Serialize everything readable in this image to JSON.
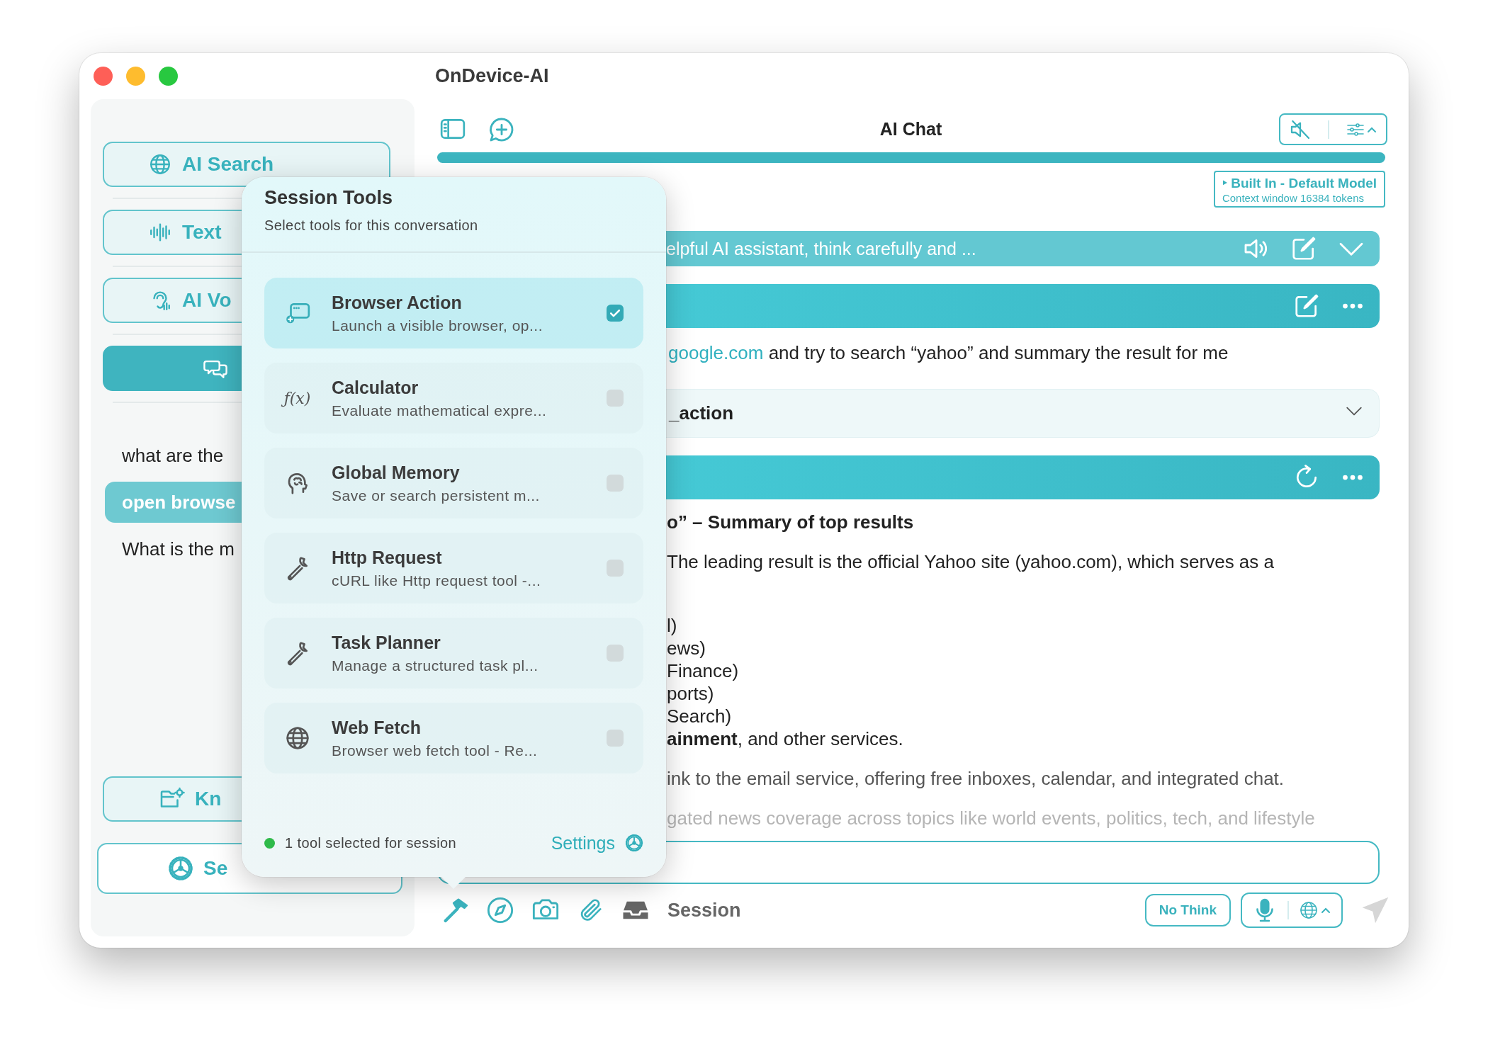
{
  "window": {
    "title": "OnDevice-AI"
  },
  "sidebar": {
    "nav": [
      {
        "label": "AI Search",
        "selected": false
      },
      {
        "label": "Text",
        "selected": false
      },
      {
        "label": "AI Vo",
        "selected": false
      },
      {
        "selected": true
      }
    ],
    "history": [
      {
        "text": "what are the",
        "selected": false
      },
      {
        "text": "open browse",
        "selected": true
      },
      {
        "text": "What is the m",
        "selected": false
      }
    ],
    "footer_buttons": [
      {
        "label": "Kn"
      },
      {
        "label": "Se"
      }
    ]
  },
  "chat": {
    "title": "AI Chat",
    "muted": true,
    "model": {
      "name": "‣ Built In - Default Model",
      "context": "Context window 16384 tokens"
    },
    "system_prompt": "elpful AI assistant, think carefully and ...",
    "user_message": {
      "link": "google.com",
      "text": "and try to search “yahoo” and summary the result for me"
    },
    "tool_call": {
      "name": "_action",
      "expanded": false
    },
    "assistant_message": {
      "heading": "o” – Summary of top results",
      "blocks": [
        {
          "kind": "paragraph",
          "lines": [
            "The leading result is the official Yahoo site (yahoo.com), which serves as a"
          ]
        },
        {
          "kind": "list",
          "lines": [
            "l)",
            "ews)",
            "Finance)",
            "ports)",
            "Search)",
            "**ainment**, and other services."
          ]
        },
        {
          "kind": "paragraph",
          "lines": [
            "ink to the email service, offering free inboxes, calendar, and integrated chat."
          ]
        },
        {
          "kind": "paragraph",
          "lines": [
            "gated news coverage across topics like world events, politics, tech, and lifestyle"
          ]
        }
      ]
    },
    "bottom_bar": {
      "session_label": "Session",
      "think_button": "No Think"
    }
  },
  "popover": {
    "title": "Session Tools",
    "subtitle": "Select tools for this conversation",
    "tools": [
      {
        "name": "Browser Action",
        "description": "Launch a visible browser, op...",
        "checked": true
      },
      {
        "name": "Calculator",
        "description": "Evaluate mathematical expre...",
        "glyph": "ƒ(x)",
        "checked": false
      },
      {
        "name": "Global Memory",
        "description": "Save or search persistent m...",
        "checked": false
      },
      {
        "name": "Http Request",
        "description": "cURL like Http request tool -...",
        "checked": false
      },
      {
        "name": "Task Planner",
        "description": "Manage a structured task pl...",
        "checked": false
      },
      {
        "name": "Web Fetch",
        "description": "Browser web fetch tool - Re...",
        "checked": false
      }
    ],
    "status": "1 tool selected for session",
    "settings_link": "Settings"
  }
}
